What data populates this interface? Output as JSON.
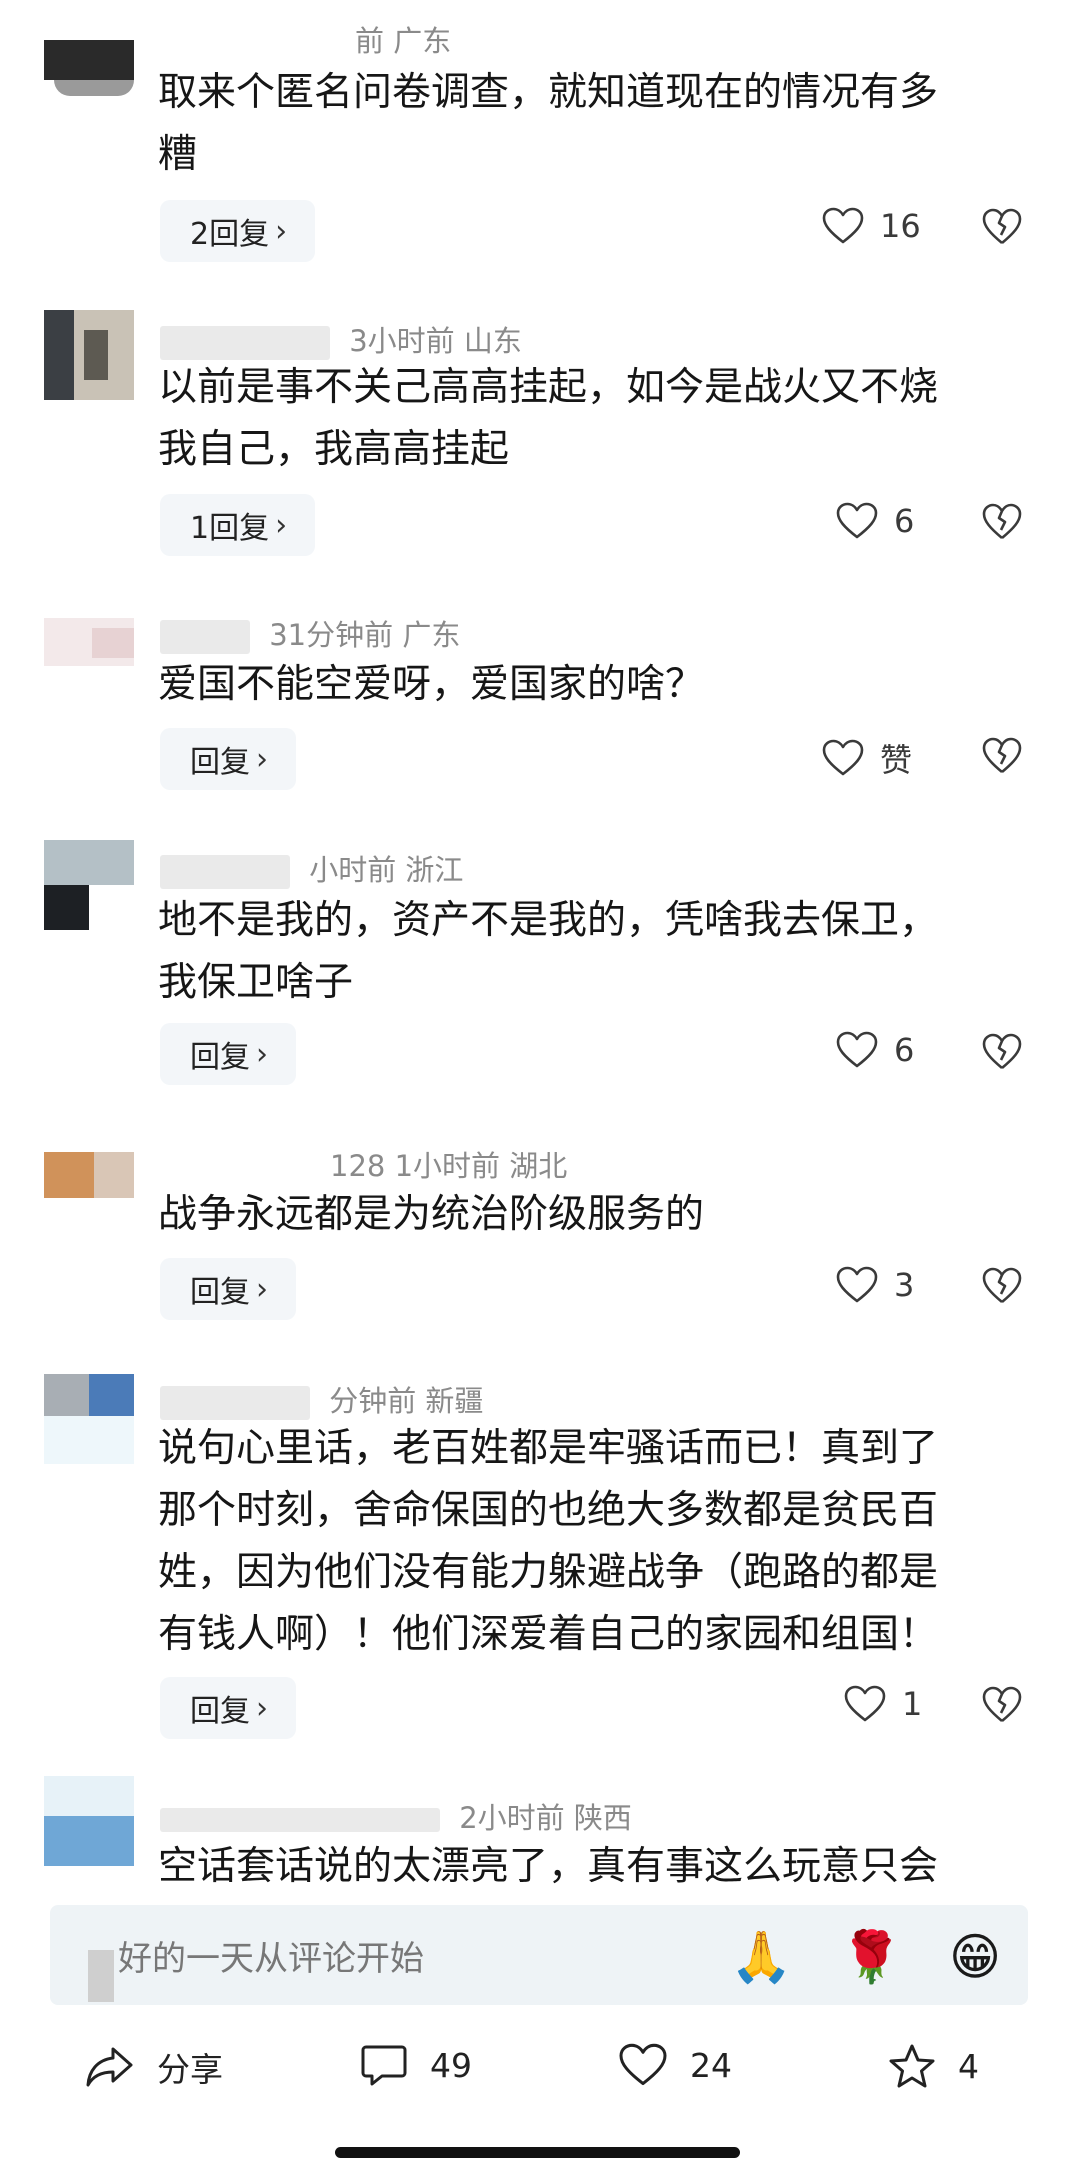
{
  "comments": [
    {
      "meta": "前  广东",
      "text_lines": [
        "取来个匿名问卷调查，就知道现在的情况有多",
        "糟"
      ],
      "reply_label": "2回复",
      "likes": "16"
    },
    {
      "meta": "3小时前  山东",
      "text_lines": [
        "以前是事不关己高高挂起，如今是战火又不烧",
        "我自己，我高高挂起"
      ],
      "reply_label": "1回复",
      "likes": "6"
    },
    {
      "meta": "31分钟前  广东",
      "text_lines": [
        "爱国不能空爱呀，爱国家的啥？"
      ],
      "reply_label": "回复",
      "likes": "赞"
    },
    {
      "meta": "小时前  浙江",
      "text_lines": [
        "地不是我的，资产不是我的，凭啥我去保卫，",
        "我保卫啥子"
      ],
      "reply_label": "回复",
      "likes": "6"
    },
    {
      "meta": "128  1小时前  湖北",
      "text_lines": [
        "战争永远都是为统治阶级服务的"
      ],
      "reply_label": "回复",
      "likes": "3"
    },
    {
      "meta": "分钟前  新疆",
      "text_lines": [
        "说句心里话，老百姓都是牢骚话而已！真到了",
        "那个时刻，舍命保国的也绝大多数都是贫民百",
        "姓，因为他们没有能力躲避战争（跑路的都是",
        "有钱人啊）！他们深爱着自己的家园和组国！"
      ],
      "reply_label": "回复",
      "likes": "1"
    },
    {
      "meta": "2小时前  陕西",
      "text_lines": [
        "空话套话说的太漂亮了，真有事这么玩意只会"
      ]
    }
  ],
  "input": {
    "placeholder": "好的一天从评论开始",
    "emojis": [
      "🙏",
      "🌹",
      "😁"
    ]
  },
  "bottom_bar": {
    "share_label": "分享",
    "comment_count": "49",
    "like_count": "24",
    "star_count": "4"
  }
}
